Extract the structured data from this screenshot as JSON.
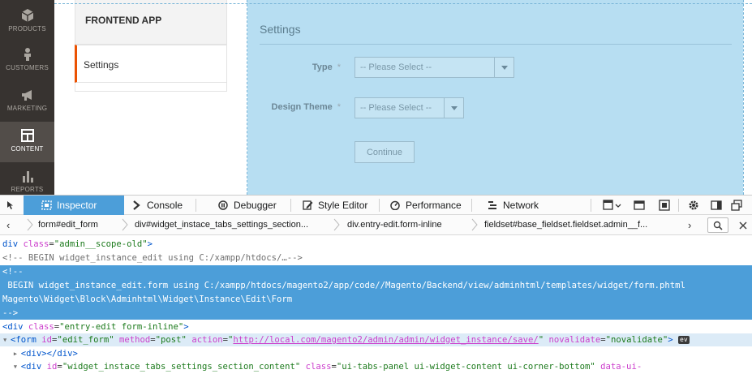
{
  "admin_nav": {
    "items": [
      {
        "label": "PRODUCTS",
        "icon": "products-icon"
      },
      {
        "label": "CUSTOMERS",
        "icon": "customers-icon"
      },
      {
        "label": "MARKETING",
        "icon": "marketing-icon"
      },
      {
        "label": "CONTENT",
        "icon": "content-icon"
      },
      {
        "label": "REPORTS",
        "icon": "reports-icon"
      }
    ],
    "active": "CONTENT"
  },
  "tabs": {
    "heading": "FRONTEND APP",
    "items": [
      {
        "label": "Settings"
      }
    ]
  },
  "settings": {
    "title": "Settings",
    "type_label": "Type",
    "type_value": "-- Please Select --",
    "theme_label": "Design Theme",
    "theme_value": "-- Please Select --",
    "required_mark": "*",
    "continue_label": "Continue"
  },
  "devtools": {
    "tabs": [
      {
        "label": "Inspector",
        "icon": "inspector-icon",
        "active": true
      },
      {
        "label": "Console",
        "icon": "console-icon"
      },
      {
        "label": "Debugger",
        "icon": "debugger-icon"
      },
      {
        "label": "Style Editor",
        "icon": "style-editor-icon"
      },
      {
        "label": "Performance",
        "icon": "performance-icon"
      },
      {
        "label": "Network",
        "icon": "network-icon"
      }
    ],
    "breadcrumbs": [
      "form#edit_form",
      "div#widget_instace_tabs_settings_section...",
      "div.entry-edit.form-inline",
      "fieldset#base_fieldset.fieldset.admin__f..."
    ]
  },
  "markup": {
    "l1_tag_open": "div ",
    "l1_attr": "class",
    "l1_val": "\"admin__scope-old\"",
    "l1_close": ">",
    "l2": "<!-- BEGIN widget_instance_edit using C:/xampp/htdocs/…-->",
    "l3": "<!--",
    "l4": " BEGIN widget_instance_edit.form using C:/xampp/htdocs/magento2/app/code//Magento/Backend/view/adminhtml/templates/widget/form.phtml",
    "l5": "Magento\\Widget\\Block\\Adminhtml\\Widget\\Instance\\Edit\\Form",
    "l6": "-->",
    "l7_tag": "<div ",
    "l7_attr": "class",
    "l7_val": "\"entry-edit form-inline\"",
    "l7_close": ">",
    "l8_tag": "<form ",
    "l8_attr1": "id",
    "l8_val1": "\"edit_form\"",
    "l8_attr2": "method",
    "l8_val2": "\"post\"",
    "l8_attr3": "action",
    "l8_val3": "http://local.com/magento2/admin/admin/widget_instance/save/",
    "l8_attr4": "novalidate",
    "l8_val4": "\"novalidate\"",
    "l8_close": ">",
    "l8_badge": "ev",
    "l9": "<div></div>",
    "l10_tag": "<div ",
    "l10_attr1": "id",
    "l10_val1": "\"widget_instace_tabs_settings_section_content\"",
    "l10_attr2": "class",
    "l10_val2": "\"ui-tabs-panel ui-widget-content ui-corner-bottom\"",
    "l10_attr3": "data-ui-"
  }
}
